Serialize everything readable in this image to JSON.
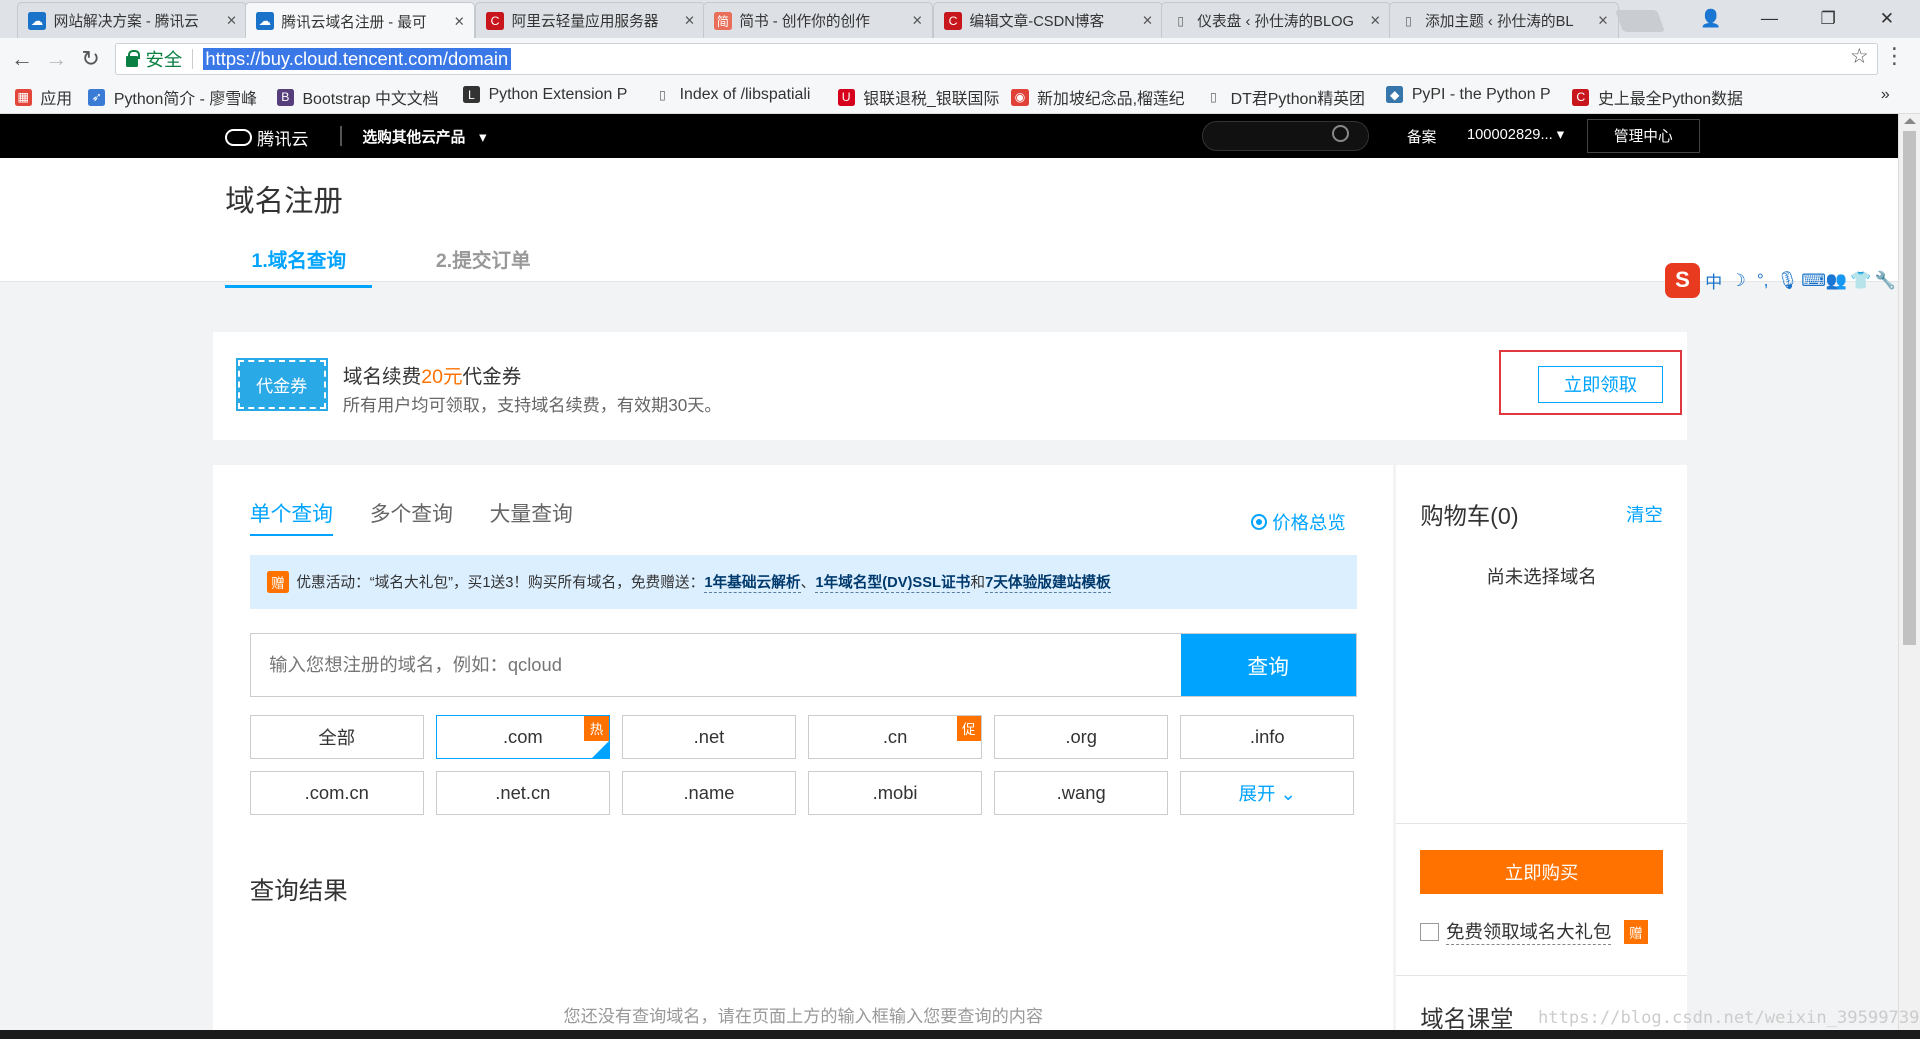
{
  "browser": {
    "tabs": [
      {
        "title": "网站解决方案 - 腾讯云",
        "icon": "cloud-icon",
        "color": "#1a73c9",
        "glyph": "☁"
      },
      {
        "title": "腾讯云域名注册 - 最可",
        "icon": "cloud-icon",
        "color": "#1a73c9",
        "glyph": "☁"
      },
      {
        "title": "阿里云轻量应用服务器",
        "icon": "csdn-c-icon",
        "color": "#c8161d",
        "glyph": "C"
      },
      {
        "title": "简书 - 创作你的创作",
        "icon": "jianshu-icon",
        "color": "#ea6f5a",
        "glyph": "简"
      },
      {
        "title": "编辑文章-CSDN博客",
        "icon": "csdn-c-icon",
        "color": "#c8161d",
        "glyph": "C"
      },
      {
        "title": "仪表盘 ‹ 孙仕涛的BLOG",
        "icon": "page-icon",
        "color": "#888888",
        "glyph": "▯"
      },
      {
        "title": "添加主题 ‹ 孙仕涛的BL",
        "icon": "page-icon",
        "color": "#888888",
        "glyph": "▯"
      }
    ],
    "secure_label": "安全",
    "url": "https://buy.cloud.tencent.com/domain",
    "bookmarks": [
      {
        "label": "应用",
        "icon": "apps-grid-icon"
      },
      {
        "label": "Python简介 - 廖雪峰",
        "icon": "rocket-icon"
      },
      {
        "label": "Bootstrap 中文文档",
        "icon": "bootstrap-icon"
      },
      {
        "label": "Python Extension P",
        "icon": "lfd-icon"
      },
      {
        "label": "Index of /libspatiali",
        "icon": "page-icon"
      },
      {
        "label": "银联退税_银联国际",
        "icon": "unionpay-icon"
      },
      {
        "label": "新加坡纪念品,榴莲纪",
        "icon": "swirl-icon"
      },
      {
        "label": "DT君Python精英团",
        "icon": "page-icon"
      },
      {
        "label": "PyPI - the Python P",
        "icon": "python-icon"
      },
      {
        "label": "史上最全Python数据",
        "icon": "csdn-c-icon"
      }
    ]
  },
  "topbar": {
    "logo_text": "腾讯云",
    "products": "选购其他云产品",
    "beian": "备案",
    "account": "100002829...",
    "console": "管理中心"
  },
  "page": {
    "title": "域名注册",
    "steps": [
      "1.域名查询",
      "2.提交订单"
    ]
  },
  "ime": {
    "items": [
      "中",
      "☽",
      "°,",
      "🎙",
      "⌨",
      "👥",
      "👕",
      "🔧"
    ]
  },
  "coupon": {
    "badge": "代金券",
    "title_prefix": "域名续费",
    "amount": "20元",
    "title_suffix": "代金券",
    "sub": "所有用户均可领取，支持域名续费，有效期30天。",
    "claim": "立即领取"
  },
  "search": {
    "tabs": [
      "单个查询",
      "多个查询",
      "大量查询"
    ],
    "price_link": "价格总览",
    "promo_badge": "赠",
    "promo_text": "优惠活动：“域名大礼包”，买1送3！购买所有域名，免费赠送：",
    "promo_link1": "1年基础云解析",
    "promo_sep1": "、",
    "promo_link2": "1年域名型(DV)SSL证书",
    "promo_sep2": "和",
    "promo_link3": "7天体验版建站模板",
    "placeholder": "输入您想注册的域名，例如：qcloud",
    "button": "查询",
    "tlds": [
      {
        "label": "全部"
      },
      {
        "label": ".com",
        "tag": "热",
        "selected": true
      },
      {
        "label": ".net"
      },
      {
        "label": ".cn",
        "tag": "促"
      },
      {
        "label": ".org"
      },
      {
        "label": ".info"
      },
      {
        "label": ".com.cn"
      },
      {
        "label": ".net.cn"
      },
      {
        "label": ".name"
      },
      {
        "label": ".mobi"
      },
      {
        "label": ".wang"
      },
      {
        "label": "展开 ⌄",
        "blue": true
      }
    ],
    "results_title": "查询结果",
    "empty_text": "您还没有查询域名，请在页面上方的输入框输入您要查询的内容"
  },
  "cart": {
    "title": "购物车(0)",
    "clear": "清空",
    "empty": "尚未选择域名",
    "buy": "立即购买",
    "gift_label": "免费领取域名大礼包",
    "gift_badge": "赠",
    "course": "域名课堂"
  },
  "watermark": "https://blog.csdn.net/weixin_39599739"
}
